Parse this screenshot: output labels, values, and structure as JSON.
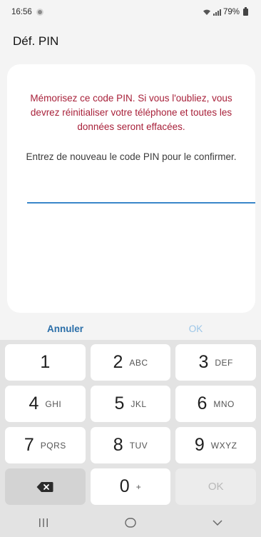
{
  "status_bar": {
    "time": "16:56",
    "battery": "79%"
  },
  "header": {
    "title": "Déf. PIN"
  },
  "card": {
    "warning": "Mémorisez ce code PIN. Si vous l'oubliez, vous devrez réinitialiser votre téléphone et toutes les données seront effacées.",
    "instruction": "Entrez de nouveau le code PIN pour le confirmer.",
    "pin_value": "",
    "accent_color": "#3a86c9",
    "warning_color": "#a8213a"
  },
  "actions": {
    "cancel_label": "Annuler",
    "ok_label": "OK"
  },
  "keypad": {
    "keys": [
      {
        "digit": "1",
        "letters": ""
      },
      {
        "digit": "2",
        "letters": "ABC"
      },
      {
        "digit": "3",
        "letters": "DEF"
      },
      {
        "digit": "4",
        "letters": "GHI"
      },
      {
        "digit": "5",
        "letters": "JKL"
      },
      {
        "digit": "6",
        "letters": "MNO"
      },
      {
        "digit": "7",
        "letters": "PQRS"
      },
      {
        "digit": "8",
        "letters": "TUV"
      },
      {
        "digit": "9",
        "letters": "WXYZ"
      }
    ],
    "zero": {
      "digit": "0",
      "letters": "+"
    },
    "ok_label": "OK",
    "backspace_icon": "backspace-icon"
  },
  "nav_bar": {
    "recent_icon": "recent-apps-icon",
    "home_icon": "home-icon",
    "back_icon": "back-chevron-icon"
  }
}
